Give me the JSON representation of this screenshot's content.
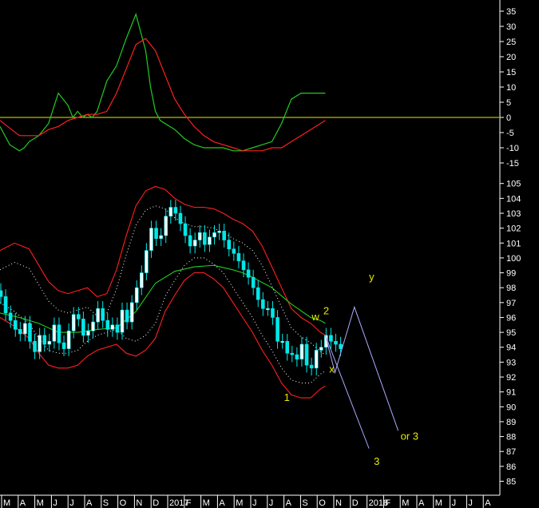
{
  "colors": {
    "background": "#000000",
    "axis": "#ffffff",
    "oscillator_fast": "#22cc22",
    "oscillator_slow": "#ff2020",
    "zero_line": "#e8e800",
    "candle_up": "#ffffff",
    "candle_down": "#00e8e8",
    "bollinger": "#ff2020",
    "moving_average": "#22cc22",
    "projection": "#aaaaff",
    "annotation": "#e8e800"
  },
  "chart_data": [
    {
      "type": "line",
      "panel": "oscillator",
      "ylim": [
        -15,
        35
      ],
      "y_ticks": [
        "35",
        "30",
        "25",
        "20",
        "15",
        "10",
        "5",
        "0",
        "-5",
        "-10",
        "-15"
      ],
      "reference_line": 0,
      "x_index_range": [
        0,
        100
      ],
      "series": [
        {
          "key": "fast",
          "color": "#22cc22",
          "x": [
            0,
            2,
            4,
            5,
            6,
            8,
            10,
            12,
            14,
            15,
            16,
            17,
            18,
            19,
            20,
            22,
            24,
            26,
            27,
            28,
            29,
            30,
            31,
            32,
            33,
            34,
            36,
            38,
            40,
            42,
            44,
            46,
            48,
            50,
            52,
            54,
            56,
            58,
            60,
            62,
            63,
            64,
            65,
            66,
            67
          ],
          "y": [
            -3,
            -9,
            -11,
            -10,
            -8,
            -6,
            -2,
            8,
            4,
            0,
            2,
            0,
            1,
            0,
            2,
            12,
            17,
            26,
            30,
            34,
            28,
            22,
            10,
            2,
            -1,
            -2,
            -4,
            -7,
            -9,
            -10,
            -10,
            -10,
            -11,
            -11,
            -10,
            -9,
            -8,
            -2,
            6,
            8,
            8,
            8,
            8,
            8,
            8
          ]
        },
        {
          "key": "slow",
          "color": "#ff2020",
          "x": [
            0,
            4,
            8,
            10,
            12,
            14,
            16,
            18,
            20,
            22,
            24,
            26,
            28,
            30,
            32,
            34,
            36,
            38,
            40,
            42,
            44,
            46,
            48,
            50,
            52,
            54,
            56,
            58,
            60,
            62,
            64,
            66,
            67
          ],
          "y": [
            -1,
            -6,
            -6,
            -4,
            -3,
            -1,
            0,
            1,
            1,
            2,
            8,
            16,
            24,
            26,
            22,
            14,
            6,
            1,
            -3,
            -6,
            -8,
            -9,
            -10,
            -11,
            -11,
            -11,
            -10,
            -10,
            -8,
            -6,
            -4,
            -2,
            -1
          ]
        }
      ]
    },
    {
      "type": "candlestick",
      "panel": "price",
      "ylim": [
        84,
        105.5
      ],
      "y_ticks": [
        "105",
        "104",
        "103",
        "102",
        "101",
        "100",
        "99",
        "98",
        "97",
        "96",
        "95",
        "94",
        "93",
        "92",
        "91",
        "90",
        "89",
        "88",
        "87",
        "86",
        "85"
      ],
      "x_ticks": [
        "M",
        "A",
        "M",
        "J",
        "J",
        "A",
        "S",
        "O",
        "N",
        "D",
        "2017",
        "F",
        "M",
        "A",
        "M",
        "J",
        "J",
        "A",
        "S",
        "O",
        "N",
        "D",
        "2018",
        "F",
        "M",
        "A",
        "M",
        "J",
        "J",
        "A"
      ],
      "x_index_range": [
        0,
        100
      ],
      "candles_close": [
        97.4,
        96.3,
        95.8,
        95.2,
        94.9,
        95.6,
        94.4,
        93.7,
        94.8,
        94.2,
        94.4,
        95.5,
        94.3,
        93.9,
        95.1,
        96.2,
        95.9,
        94.8,
        95.1,
        95.7,
        96.6,
        95.8,
        95.2,
        95.5,
        95.0,
        96.5,
        95.7,
        97.0,
        98.0,
        99.0,
        100.5,
        102.0,
        101.3,
        101.5,
        102.8,
        103.4,
        103.0,
        102.3,
        101.5,
        100.8,
        101.2,
        101.7,
        100.9,
        101.4,
        101.7,
        101.8,
        101.2,
        100.6,
        100.3,
        99.8,
        99.2,
        98.7,
        98.0,
        97.2,
        96.6,
        96.6,
        96.0,
        94.4,
        94.4,
        93.6,
        93.5,
        93.2,
        94.2,
        92.8,
        92.6,
        93.8,
        94.0,
        94.8,
        94.4,
        94.2,
        93.9
      ],
      "series": [
        {
          "key": "bb_upper",
          "color": "#ff2020",
          "x": [
            0,
            3,
            6,
            8,
            10,
            12,
            14,
            16,
            18,
            20,
            22,
            24,
            26,
            28,
            30,
            32,
            34,
            36,
            38,
            40,
            42,
            44,
            46,
            48,
            50,
            52,
            54,
            56,
            58,
            60,
            62,
            64,
            66,
            67
          ],
          "y": [
            100.5,
            101.0,
            100.6,
            99.5,
            98.4,
            97.8,
            97.6,
            97.8,
            98.0,
            97.4,
            97.6,
            99.2,
            101.5,
            103.5,
            104.5,
            104.8,
            104.6,
            104.0,
            103.6,
            103.4,
            103.4,
            103.3,
            103.0,
            102.6,
            102.3,
            101.8,
            100.8,
            99.4,
            98.0,
            96.6,
            96.0,
            95.6,
            95.0,
            94.8
          ]
        },
        {
          "key": "bb_lower",
          "color": "#ff2020",
          "x": [
            0,
            3,
            6,
            8,
            10,
            12,
            14,
            16,
            18,
            20,
            22,
            24,
            26,
            28,
            30,
            32,
            34,
            36,
            38,
            40,
            42,
            44,
            46,
            48,
            50,
            52,
            54,
            56,
            58,
            60,
            62,
            64,
            66,
            67
          ],
          "y": [
            96.0,
            95.4,
            94.6,
            93.6,
            92.8,
            92.6,
            92.6,
            92.8,
            93.4,
            93.8,
            94.0,
            94.2,
            93.6,
            93.4,
            93.8,
            94.6,
            96.4,
            97.5,
            98.5,
            99.0,
            99.0,
            98.6,
            98.0,
            97.0,
            96.0,
            95.0,
            93.8,
            92.8,
            91.6,
            90.8,
            90.6,
            90.6,
            91.2,
            91.4
          ]
        },
        {
          "key": "ma",
          "color": "#22cc22",
          "x": [
            0,
            4,
            8,
            12,
            16,
            20,
            24,
            28,
            32,
            36,
            40,
            44,
            48,
            50,
            52,
            56,
            60,
            64,
            66,
            67
          ],
          "y": [
            96.3,
            96.0,
            95.6,
            95.0,
            95.0,
            95.2,
            95.3,
            96.4,
            98.3,
            99.1,
            99.4,
            99.5,
            99.2,
            99.0,
            98.7,
            98.0,
            96.9,
            96.0,
            95.8,
            95.6
          ]
        }
      ],
      "projection": {
        "color": "#aaaaff",
        "x": [
          67,
          69,
          73,
          82
        ],
        "y": [
          94.8,
          92.3,
          96.7,
          88.4
        ],
        "alt": {
          "x": [
            67,
            76
          ],
          "y": [
            94.8,
            87.2
          ]
        }
      },
      "annotations": [
        {
          "label": "w",
          "x": 64.2,
          "y": 95.8
        },
        {
          "label": "2",
          "x": 66.6,
          "y": 96.2
        },
        {
          "label": "x",
          "x": 67.8,
          "y": 92.3
        },
        {
          "label": "y",
          "x": 76.0,
          "y": 98.5
        },
        {
          "label": "1",
          "x": 58.5,
          "y": 90.4
        },
        {
          "label": "3",
          "x": 77.0,
          "y": 86.1
        },
        {
          "label": "or 3",
          "x": 82.5,
          "y": 87.8
        }
      ]
    }
  ]
}
